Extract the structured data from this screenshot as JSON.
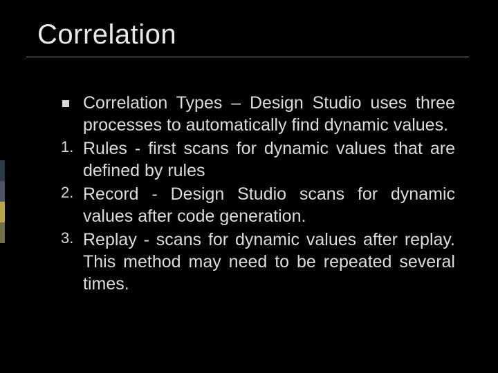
{
  "title": "Correlation",
  "intro": "Correlation Types – Design Studio uses three processes to automatically find dynamic values.",
  "items": [
    {
      "num": "1.",
      "text": "Rules - first scans for dynamic values that are defined by rules"
    },
    {
      "num": "2.",
      "text": "Record - Design Studio scans for dynamic values after code generation."
    },
    {
      "num": "3.",
      "text": "Replay - scans for dynamic values after replay. This method may need to be repeated several times."
    }
  ]
}
